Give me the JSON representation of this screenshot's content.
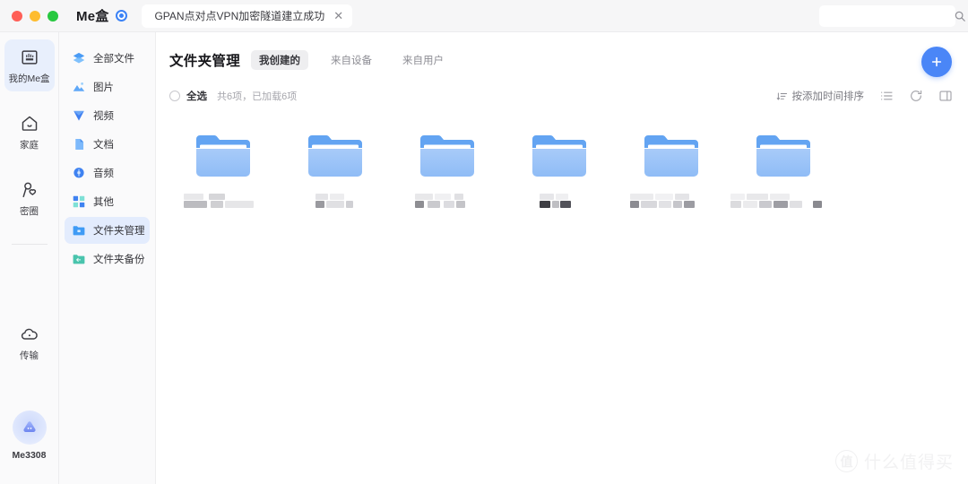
{
  "window": {
    "brand": "Me盒",
    "tab_title": "GPAN点对点VPN加密隧道建立成功",
    "tab_close": "✕"
  },
  "search": {
    "value": "",
    "placeholder": ""
  },
  "rail": {
    "items": [
      {
        "label": "我的Me盒",
        "icon": "mebox-icon",
        "active": true
      },
      {
        "label": "家庭",
        "icon": "home-icon",
        "active": false
      },
      {
        "label": "密圈",
        "icon": "circle-friends-icon",
        "active": false
      },
      {
        "label": "传输",
        "icon": "transfer-cloud-icon",
        "active": false
      }
    ],
    "device": {
      "name": "Me3308",
      "icon": "device-avatar-icon"
    }
  },
  "nav2": {
    "items": [
      {
        "label": "全部文件",
        "icon": "all-files-icon",
        "active": false
      },
      {
        "label": "图片",
        "icon": "image-icon",
        "active": false
      },
      {
        "label": "视频",
        "icon": "video-icon",
        "active": false
      },
      {
        "label": "文档",
        "icon": "document-icon",
        "active": false
      },
      {
        "label": "音频",
        "icon": "audio-icon",
        "active": false
      },
      {
        "label": "其他",
        "icon": "other-icon",
        "active": false
      },
      {
        "label": "文件夹管理",
        "icon": "folder-manage-icon",
        "active": true
      },
      {
        "label": "文件夹备份",
        "icon": "folder-backup-icon",
        "active": false
      }
    ]
  },
  "main": {
    "title": "文件夹管理",
    "tabs": [
      {
        "label": "我创建的",
        "active": true
      },
      {
        "label": "来自设备",
        "active": false
      },
      {
        "label": "来自用户",
        "active": false
      }
    ],
    "add_button": "+",
    "toolbar": {
      "select_all": "全选",
      "count": "共6项，已加载6项",
      "sort_label": "按添加时间排序",
      "icons": [
        "list-view-icon",
        "refresh-icon",
        "split-panel-icon"
      ]
    },
    "folders": [
      {
        "name": "",
        "redacted": true
      },
      {
        "name": "",
        "redacted": true
      },
      {
        "name": "",
        "redacted": true
      },
      {
        "name": "",
        "redacted": true
      },
      {
        "name": "",
        "redacted": true
      },
      {
        "name": "",
        "redacted": true
      }
    ]
  },
  "watermark": {
    "mark": "值",
    "text": "什么值得买"
  },
  "colors": {
    "accent": "#4a86f7",
    "folder_front": "#9dc3f7",
    "folder_back": "#6aa6f2",
    "active_nav_bg": "#e3ecfd"
  }
}
